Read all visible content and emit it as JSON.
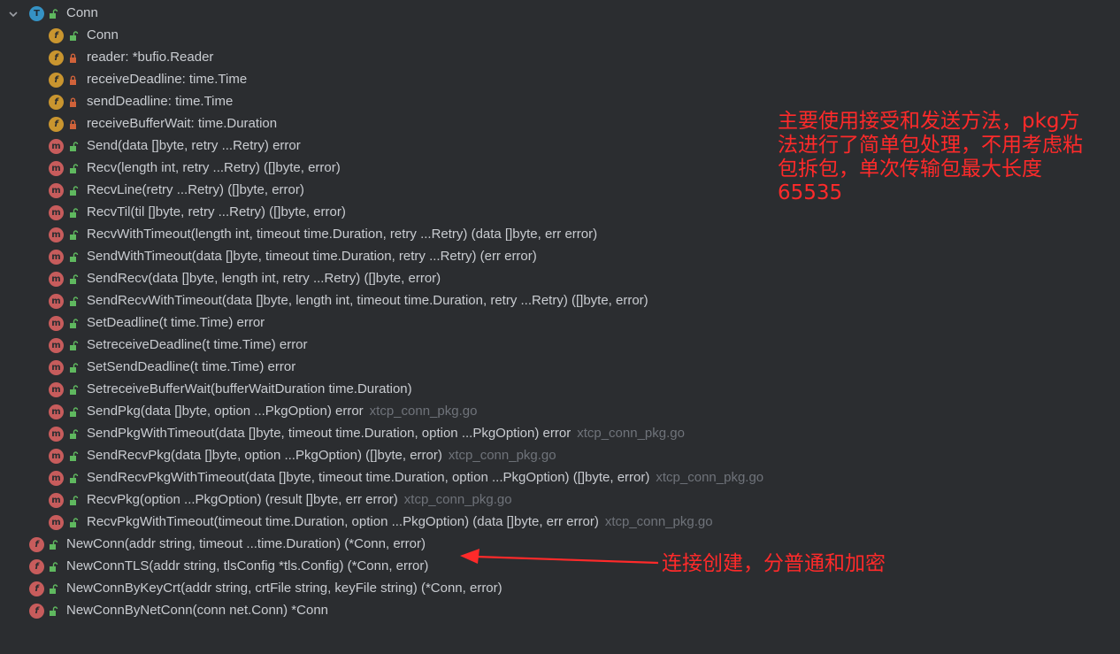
{
  "tree": {
    "root": {
      "label": "Conn",
      "kind": "T",
      "expanded": true,
      "icon": "chevron-down-icon"
    },
    "members": [
      {
        "kind": "f",
        "visibility": "public",
        "label": "Conn",
        "file": ""
      },
      {
        "kind": "f",
        "visibility": "private",
        "label": "reader: *bufio.Reader",
        "file": ""
      },
      {
        "kind": "f",
        "visibility": "private",
        "label": "receiveDeadline: time.Time",
        "file": ""
      },
      {
        "kind": "f",
        "visibility": "private",
        "label": "sendDeadline: time.Time",
        "file": ""
      },
      {
        "kind": "f",
        "visibility": "private",
        "label": "receiveBufferWait: time.Duration",
        "file": ""
      },
      {
        "kind": "m",
        "visibility": "public",
        "label": "Send(data []byte, retry ...Retry) error",
        "file": ""
      },
      {
        "kind": "m",
        "visibility": "public",
        "label": "Recv(length int, retry ...Retry) ([]byte, error)",
        "file": ""
      },
      {
        "kind": "m",
        "visibility": "public",
        "label": "RecvLine(retry ...Retry) ([]byte, error)",
        "file": ""
      },
      {
        "kind": "m",
        "visibility": "public",
        "label": "RecvTil(til []byte, retry ...Retry) ([]byte, error)",
        "file": ""
      },
      {
        "kind": "m",
        "visibility": "public",
        "label": "RecvWithTimeout(length int, timeout time.Duration, retry ...Retry) (data []byte, err error)",
        "file": ""
      },
      {
        "kind": "m",
        "visibility": "public",
        "label": "SendWithTimeout(data []byte, timeout time.Duration, retry ...Retry) (err error)",
        "file": ""
      },
      {
        "kind": "m",
        "visibility": "public",
        "label": "SendRecv(data []byte, length int, retry ...Retry) ([]byte, error)",
        "file": ""
      },
      {
        "kind": "m",
        "visibility": "public",
        "label": "SendRecvWithTimeout(data []byte, length int, timeout time.Duration, retry ...Retry) ([]byte, error)",
        "file": ""
      },
      {
        "kind": "m",
        "visibility": "public",
        "label": "SetDeadline(t time.Time) error",
        "file": ""
      },
      {
        "kind": "m",
        "visibility": "public",
        "label": "SetreceiveDeadline(t time.Time) error",
        "file": ""
      },
      {
        "kind": "m",
        "visibility": "public",
        "label": "SetSendDeadline(t time.Time) error",
        "file": ""
      },
      {
        "kind": "m",
        "visibility": "public",
        "label": "SetreceiveBufferWait(bufferWaitDuration time.Duration)",
        "file": ""
      },
      {
        "kind": "m",
        "visibility": "public",
        "label": "SendPkg(data []byte, option ...PkgOption) error",
        "file": "xtcp_conn_pkg.go"
      },
      {
        "kind": "m",
        "visibility": "public",
        "label": "SendPkgWithTimeout(data []byte, timeout time.Duration, option ...PkgOption) error",
        "file": "xtcp_conn_pkg.go"
      },
      {
        "kind": "m",
        "visibility": "public",
        "label": "SendRecvPkg(data []byte, option ...PkgOption) ([]byte, error)",
        "file": "xtcp_conn_pkg.go"
      },
      {
        "kind": "m",
        "visibility": "public",
        "label": "SendRecvPkgWithTimeout(data []byte, timeout time.Duration, option ...PkgOption) ([]byte, error)",
        "file": "xtcp_conn_pkg.go"
      },
      {
        "kind": "m",
        "visibility": "public",
        "label": "RecvPkg(option ...PkgOption) (result []byte, err error)",
        "file": "xtcp_conn_pkg.go"
      },
      {
        "kind": "m",
        "visibility": "public",
        "label": "RecvPkgWithTimeout(timeout time.Duration, option ...PkgOption) (data []byte, err error)",
        "file": "xtcp_conn_pkg.go"
      }
    ],
    "functions": [
      {
        "kind": "f",
        "visibility": "public",
        "label": "NewConn(addr string, timeout ...time.Duration) (*Conn, error)"
      },
      {
        "kind": "f",
        "visibility": "public",
        "label": "NewConnTLS(addr string, tlsConfig *tls.Config) (*Conn, error)"
      },
      {
        "kind": "f",
        "visibility": "public",
        "label": "NewConnByKeyCrt(addr string, crtFile string, keyFile string) (*Conn, error)"
      },
      {
        "kind": "f",
        "visibility": "public",
        "label": "NewConnByNetConn(conn net.Conn) *Conn"
      }
    ]
  },
  "annotations": {
    "main_note": "主要使用接受和发送方法，pkg方\n法进行了简单包处理，不用考虑粘\n包拆包，单次传输包最大长度\n65535",
    "conn_note": "连接创建，分普通和加密",
    "color": "#ff2a2a"
  },
  "colors": {
    "background": "#2b2d30",
    "text": "#c9ccd1",
    "file_hint": "#6f737a",
    "type_badge": "#3592c4",
    "field_badge": "#c9952f",
    "method_badge": "#c75c5c",
    "public_lock": "#5fb85f",
    "private_lock": "#d0623a"
  }
}
